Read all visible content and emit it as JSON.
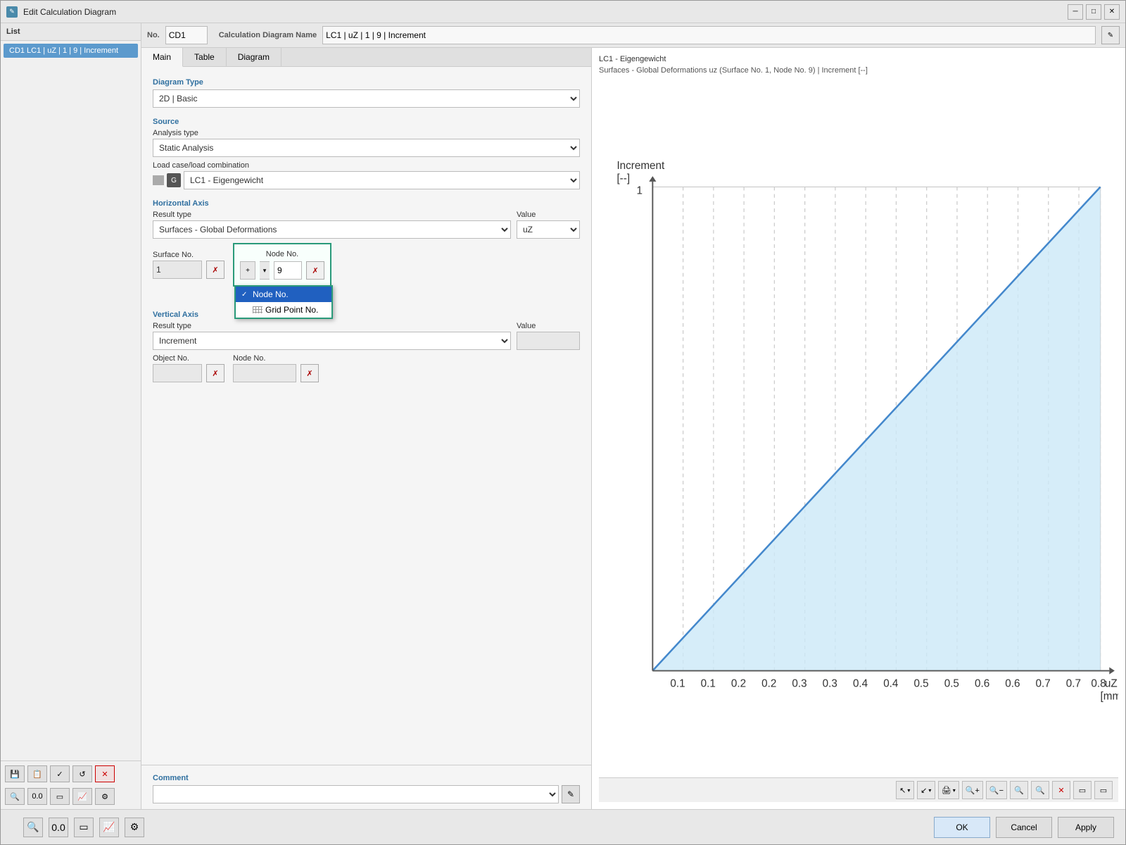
{
  "window": {
    "title": "Edit Calculation Diagram",
    "min_btn": "─",
    "max_btn": "□",
    "close_btn": "✕"
  },
  "list": {
    "header": "List",
    "item": "CD1  LC1 | uZ | 1 | 9 | Increment"
  },
  "no_label": "No.",
  "cd_no": "CD1",
  "calc_name_label": "Calculation Diagram Name",
  "calc_name_value": "LC1 | uZ | 1 | 9 | Increment",
  "tabs": [
    "Main",
    "Table",
    "Diagram"
  ],
  "active_tab": "Main",
  "diagram_type": {
    "label": "Diagram Type",
    "value": "2D | Basic"
  },
  "source": {
    "label": "Source",
    "analysis_type_label": "Analysis type",
    "analysis_type_value": "Static Analysis",
    "load_case_label": "Load case/load combination",
    "load_case_value": "LC1 - Eigengewicht"
  },
  "horizontal_axis": {
    "label": "Horizontal Axis",
    "result_type_label": "Result type",
    "result_type_value": "Surfaces - Global Deformations",
    "value_label": "Value",
    "value_value": "uZ",
    "surface_no_label": "Surface No.",
    "surface_no_value": "1",
    "node_no_label": "Node No.",
    "node_no_value": "9",
    "dropdown_options": [
      {
        "label": "Node No.",
        "selected": true
      },
      {
        "label": "Grid Point No.",
        "selected": false
      }
    ]
  },
  "vertical_axis": {
    "label": "Vertical Axis",
    "result_type_label": "Result type",
    "result_type_value": "Increment",
    "value_label": "Value",
    "value_value": "",
    "object_no_label": "Object No.",
    "object_no_value": "",
    "node_no_label": "Node No.",
    "node_no_value": ""
  },
  "comment": {
    "label": "Comment",
    "value": ""
  },
  "chart": {
    "title": "LC1 - Eigengewicht",
    "subtitle": "Surfaces - Global Deformations uz (Surface No. 1, Node No. 9) | Increment [--]",
    "x_axis_label": "uZ",
    "x_axis_unit": "[mm]",
    "y_axis_label": "Increment",
    "y_axis_unit": "[--]",
    "y_max": "1",
    "x_ticks": [
      "0.1",
      "0.1",
      "0.2",
      "0.2",
      "0.3",
      "0.3",
      "0.4",
      "0.4",
      "0.5",
      "0.5",
      "0.6",
      "0.6",
      "0.7",
      "0.7",
      "0.8"
    ]
  },
  "toolbar": {
    "btn1": "↖↗",
    "btn2": "↙↘",
    "btn3": "🖨",
    "btn4": "🔍+",
    "btn5": "🔍-",
    "btn6": "🔍",
    "btn7": "🔍",
    "btn8": "✕",
    "btn9": "▭",
    "btn10": "▭"
  },
  "bottom": {
    "ok_label": "OK",
    "cancel_label": "Cancel",
    "apply_label": "Apply"
  },
  "footer_icons": [
    "💾",
    "📋",
    "✓✓",
    "↺",
    "✕"
  ]
}
